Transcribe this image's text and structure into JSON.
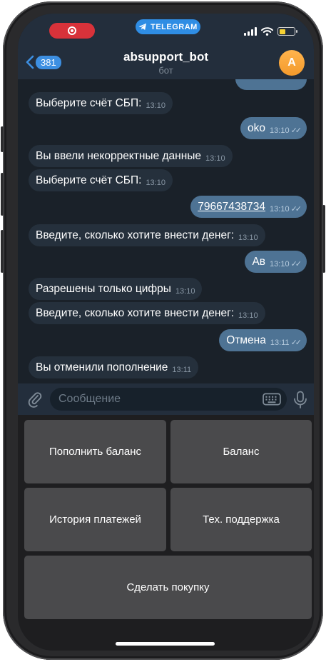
{
  "status": {
    "app_pill": "TELEGRAM"
  },
  "header": {
    "back_count": "381",
    "title": "absupport_bot",
    "subtitle": "бот",
    "avatar_initial": "A"
  },
  "messages": [
    {
      "dir": "in",
      "text": "Выберите счёт СБП:",
      "time": "13:10"
    },
    {
      "dir": "out",
      "text": "oko",
      "time": "13:10"
    },
    {
      "dir": "in",
      "text": "Вы ввели некорректные данные",
      "time": "13:10"
    },
    {
      "dir": "in",
      "text": "Выберите счёт СБП:",
      "time": "13:10"
    },
    {
      "dir": "out",
      "text": "79667438734",
      "time": "13:10"
    },
    {
      "dir": "in",
      "text": "Введите, сколько хотите внести денег:",
      "time": "13:10"
    },
    {
      "dir": "out",
      "text": "Ав",
      "time": "13:10"
    },
    {
      "dir": "in",
      "text": "Разрешены только цифры",
      "time": "13:10"
    },
    {
      "dir": "in",
      "text": "Введите, сколько хотите внести денег:",
      "time": "13:10"
    },
    {
      "dir": "out",
      "text": "Отмена",
      "time": "13:11"
    },
    {
      "dir": "in",
      "text": "Вы отменили пополнение",
      "time": "13:11"
    }
  ],
  "composer": {
    "placeholder": "Сообщение"
  },
  "keyboard": {
    "top_up": "Пополнить баланс",
    "balance": "Баланс",
    "history": "История платежей",
    "support": "Тех. поддержка",
    "purchase": "Сделать покупку"
  },
  "colors": {
    "chat_bg": "#1a2129",
    "incoming": "#25303c",
    "outgoing": "#4e7394",
    "accent": "#3d8fe1",
    "recording": "#d8323a",
    "battery": "#f7d233"
  },
  "icons": {
    "recording": "record-icon",
    "telegram": "telegram-plane-icon",
    "signal": "cellular-signal-icon",
    "wifi": "wifi-icon",
    "battery": "battery-icon",
    "back": "chevron-left-icon",
    "attach": "paperclip-icon",
    "bot_keyboard": "keyboard-icon",
    "mic": "microphone-icon",
    "read": "double-check-icon"
  }
}
